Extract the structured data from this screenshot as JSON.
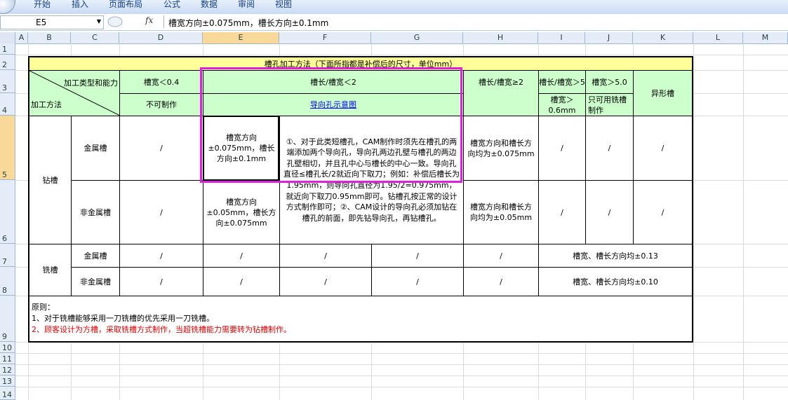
{
  "ribbon": {
    "tabs": [
      "开始",
      "插入",
      "页面布局",
      "公式",
      "数据",
      "审阅",
      "视图"
    ]
  },
  "formula_bar": {
    "cell_ref": "E5",
    "fx": "fx",
    "content": "槽宽方向±0.075mm，槽长方向±0.1mm"
  },
  "columns": [
    "A",
    "B",
    "C",
    "D",
    "E",
    "F",
    "G",
    "H",
    "I",
    "J",
    "K",
    "L",
    "M"
  ],
  "selected_column": "E",
  "rows": [
    "1",
    "2",
    "3",
    "4",
    "5",
    "6",
    "7",
    "8",
    "9",
    "10",
    "11",
    "12",
    "13",
    "14"
  ],
  "selected_row": "5",
  "table": {
    "title": "槽孔加工方法（下面所指都是补偿后的尺寸，单位mm）",
    "diag_top": "加工类型和能力",
    "diag_bottom": "加工方法",
    "h_d3": "槽宽＜0.4",
    "h_d4": "不可制作",
    "h_e3": "槽长/槽宽＜2",
    "h_e4_link": "导向孔示意图",
    "h_h3": "槽长/槽宽≥2",
    "h_i3": "槽长/槽宽＞5",
    "h_i4": "槽宽＞0.6mm",
    "h_j3": "槽宽＞5.0",
    "h_j4": "只可用铣槽制作",
    "h_k": "异形槽",
    "drill": "钻槽",
    "metal": "金属槽",
    "nonmetal": "非金属槽",
    "mill": "铣槽",
    "slash": "/",
    "e5": "槽宽方向±0.075mm，槽长方向±0.1mm",
    "e6": "槽宽方向±0.05mm，槽长方向±0.075mm",
    "f5_notes": "①、对于此类短槽孔，CAM制作时须先在槽孔的两端添加两个导向孔，导向孔两边孔壁与槽孔的两边孔壁相切，并且孔中心与槽长的中心一致。导向孔直径≤槽孔长/2就近向下取刀；例如：补偿后槽长为1.95mm，则导向孔直径为1.95/2=0.975mm，就近向下取刀0.95mm即可。钻槽孔按正常的设计方式制作即可；②、CAM设计的导向孔必须加钻在槽孔的前面，即先钻导向孔，再钻槽孔。",
    "h5": "槽宽方向和槽长方向均为±0.075mm",
    "h6": "槽宽方向和槽长方向均为±0.05mm",
    "ik7": "槽宽、槽长方向均±0.13",
    "ik8": "槽宽、槽长方向均±0.10",
    "principle_title": "原则：",
    "principle_1": "1、对于铣槽能够采用一刀铣槽的优先采用一刀铣槽。",
    "principle_2": "2、顾客设计为方槽，采取铣槽方式制作，当超铣槽能力需要转为钻槽制作。"
  },
  "colors": {
    "header_green": "#ccffcc",
    "title_yellow": "#ffff99",
    "highlight": "#e020e0",
    "red_text": "#e00000"
  }
}
